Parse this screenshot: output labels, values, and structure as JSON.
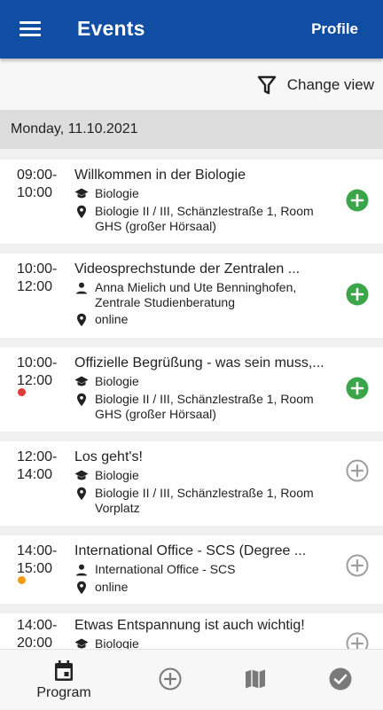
{
  "appbar": {
    "title": "Events",
    "profile_label": "Profile",
    "color": "#0f4ea3"
  },
  "toolbar": {
    "change_view_label": "Change view",
    "icon": "filter-icon"
  },
  "date_header": "Monday, 11.10.2021",
  "events": [
    {
      "start": "09:00-",
      "end": "10:00",
      "title": "Willkommen in der Biologie",
      "category": "Biologie",
      "location": [
        "Biologie II / III, Schänzlestraße 1, Room",
        "GHS (großer Hörsaal)"
      ],
      "added": true
    },
    {
      "start": "10:00-",
      "end": "12:00",
      "title": "Videosprechstunde der Zentralen ...",
      "person": [
        "Anna Mielich und Ute Benninghofen,",
        "Zentrale Studienberatung"
      ],
      "location": [
        "online"
      ],
      "added": true
    },
    {
      "start": "10:00-",
      "end": "12:00",
      "title": "Offizielle Begrüßung - was sein muss,...",
      "category": "Biologie",
      "location": [
        "Biologie II / III, Schänzlestraße 1, Room",
        "GHS (großer Hörsaal)"
      ],
      "added": true,
      "dot_color": "#e53935"
    },
    {
      "start": "12:00-",
      "end": "14:00",
      "title": "Los geht's!",
      "category": "Biologie",
      "location": [
        "Biologie II / III, Schänzlestraße 1, Room",
        "Vorplatz"
      ],
      "added": false
    },
    {
      "start": "14:00-",
      "end": "15:00",
      "title": "International Office - SCS (Degree ...",
      "person": [
        "International Office - SCS"
      ],
      "location": [
        "online"
      ],
      "added": false,
      "dot_color": "#f39c12"
    },
    {
      "start": "14:00-",
      "end": "20:00",
      "title": "Etwas Entspannung ist auch wichtig!",
      "category": "Biologie",
      "added": false
    }
  ],
  "bottom_nav": [
    {
      "label": "Program",
      "icon": "calendar-icon",
      "active": true
    },
    {
      "label": "",
      "icon": "add-circle-icon"
    },
    {
      "label": "",
      "icon": "map-icon"
    },
    {
      "label": "",
      "icon": "check-circle-icon"
    }
  ],
  "colors": {
    "added_green": "#3ba54a",
    "not_added_gray": "#9e9e9e"
  }
}
